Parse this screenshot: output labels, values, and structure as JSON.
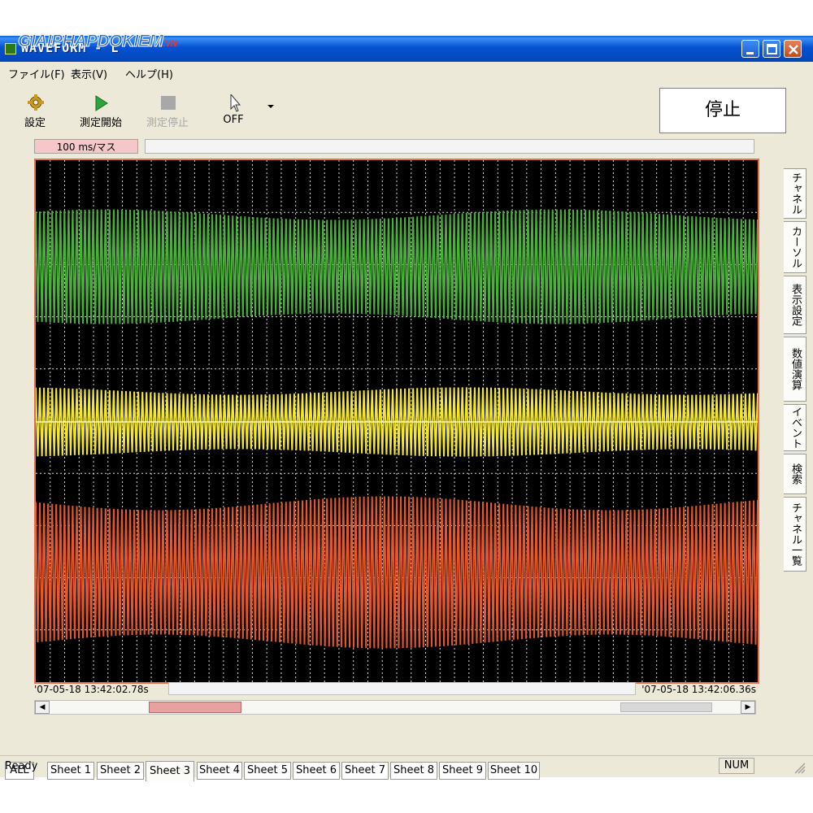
{
  "window": {
    "title": "WAVEFORM - L",
    "watermark": "GIAIPHAPDOKIEM",
    "watermark_suffix": ".VN"
  },
  "menu": [
    "ファイル(F)",
    "表示(V)",
    "ヘルプ(H)"
  ],
  "toolbar": {
    "settings_label": "設定",
    "start_label": "測定開始",
    "stop_label": "測定停止",
    "cursor_label": "OFF",
    "status": "停止"
  },
  "plot": {
    "timebase": "100 ms/マス",
    "start_time": "'07-05-18 13:42:02.78s",
    "end_time": "'07-05-18 13:42:06.36s"
  },
  "colors": {
    "channel1": "#4caf3c",
    "channel2": "#f2e633",
    "channel3": "#e4582c",
    "grid": "#ffffff",
    "title_bar": "#0a5ed8"
  },
  "sheet_tabs": [
    "ALL",
    "Sheet 1",
    "Sheet 2",
    "Sheet 3",
    "Sheet 4",
    "Sheet 5",
    "Sheet 6",
    "Sheet 7",
    "Sheet 8",
    "Sheet 9",
    "Sheet 10"
  ],
  "active_sheet": "Sheet 3",
  "side_tabs": [
    "チャネル",
    "カーソル",
    "表示設定",
    "数値演算",
    "イベント",
    "検索",
    "チャネル一覧"
  ],
  "status_bar": {
    "ready": "Ready",
    "num": "NUM"
  }
}
